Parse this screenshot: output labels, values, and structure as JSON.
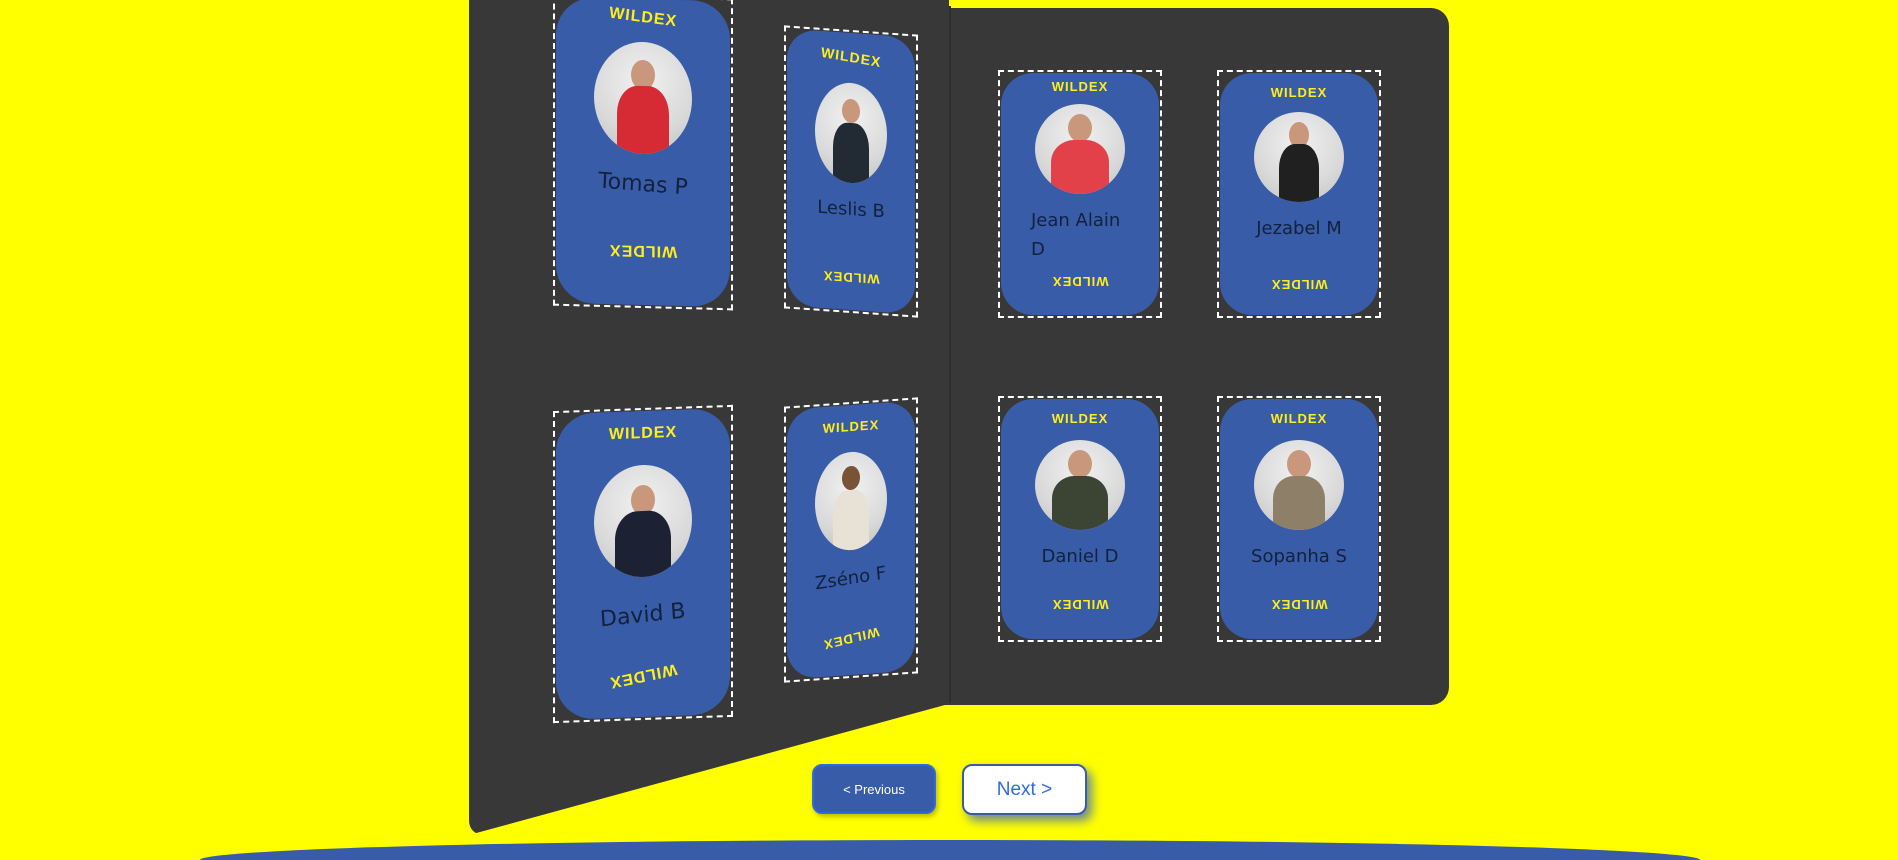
{
  "album": {
    "left_page_cards": [
      {
        "brand_top": "WILDEX",
        "name": "Tomas P",
        "brand_bottom": "WILDEX",
        "shirt": "#d62a34"
      },
      {
        "brand_top": "WILDEX",
        "name": "Leslis B",
        "brand_bottom": "WILDEX",
        "shirt": "#222a33"
      },
      {
        "brand_top": "WILDEX",
        "name": "David B",
        "brand_bottom": "WILDEX",
        "shirt": "#1c2234"
      },
      {
        "brand_top": "WILDEX",
        "name": "Zséno F",
        "brand_bottom": "WILDEX",
        "shirt": "#e8e2d6"
      }
    ],
    "right_page_cards": [
      {
        "brand_top": "WILDEX",
        "name_line1": "Jean Alain",
        "name_line2": "D",
        "brand_bottom": "WILDEX",
        "shirt": "#e2414a"
      },
      {
        "brand_top": "WILDEX",
        "name": "Jezabel M",
        "brand_bottom": "WILDEX",
        "shirt": "#202020"
      },
      {
        "brand_top": "WILDEX",
        "name": "Daniel D",
        "brand_bottom": "WILDEX",
        "shirt": "#3c4434"
      },
      {
        "brand_top": "WILDEX",
        "name": "Sopanha S",
        "brand_bottom": "WILDEX",
        "shirt": "#8e8068"
      }
    ]
  },
  "navigation": {
    "previous_label": "< Previous",
    "next_label": "Next >"
  },
  "colors": {
    "background": "#ffff00",
    "album": "#383838",
    "card": "#385ca8",
    "brand_text": "#ffee1a",
    "accent": "#2f6ae0"
  }
}
